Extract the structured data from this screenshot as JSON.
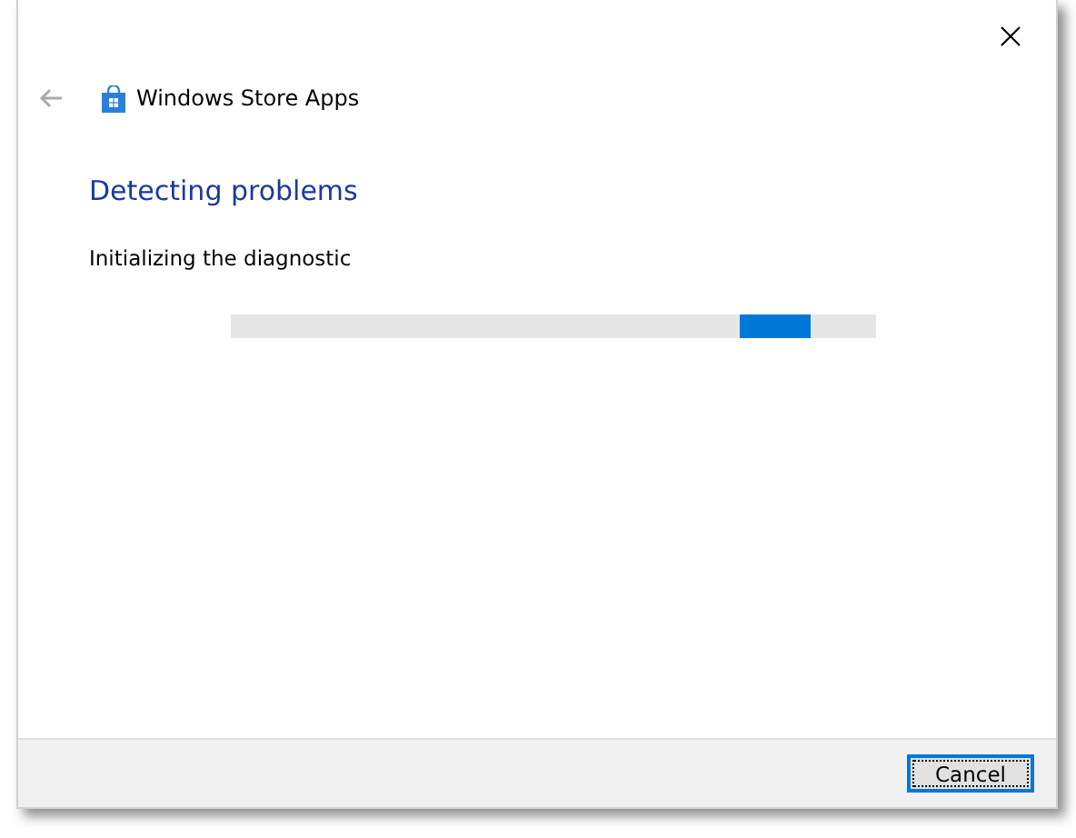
{
  "window": {
    "title": "Windows Store Apps"
  },
  "heading": "Detecting problems",
  "status": "Initializing the diagnostic",
  "progress": {
    "kind": "marquee",
    "level": 0.9
  },
  "buttons": [
    {
      "label": "Cancel",
      "focused": true
    }
  ]
}
